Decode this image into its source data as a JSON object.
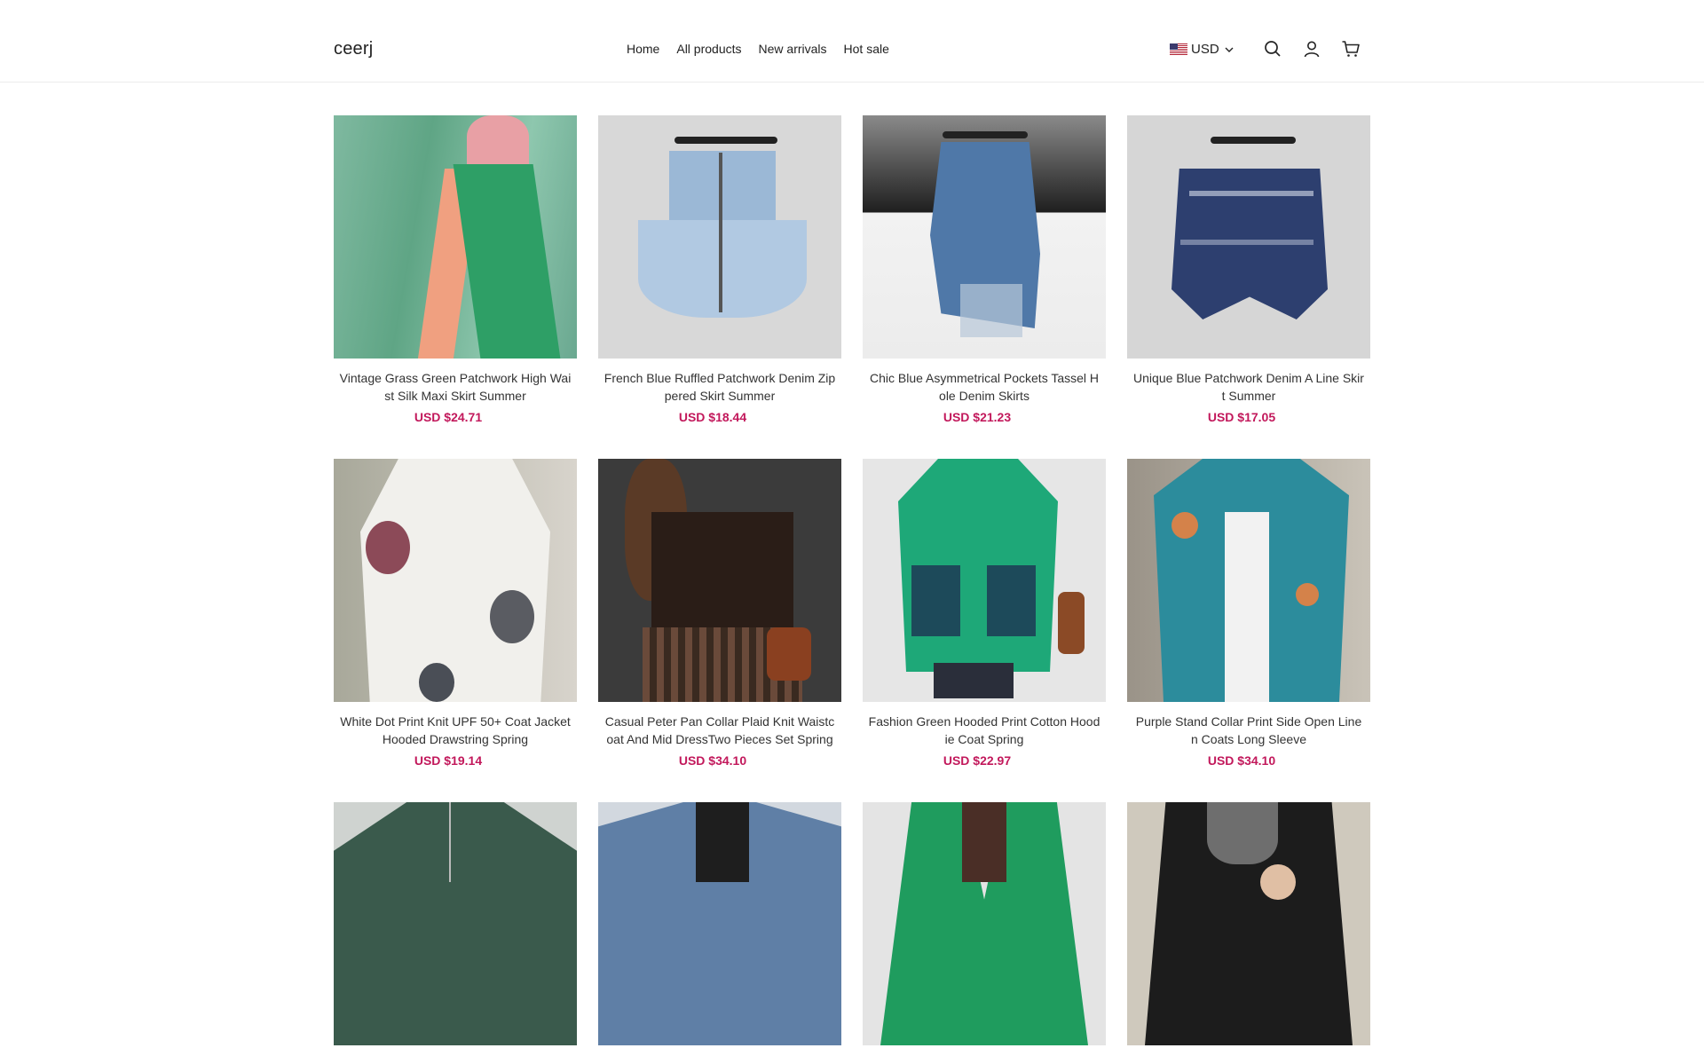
{
  "header": {
    "logo": "ceerj",
    "nav": [
      "Home",
      "All products",
      "New arrivals",
      "Hot sale"
    ],
    "currency": "USD",
    "icons": [
      "us-flag-icon",
      "chevron-down-icon",
      "search-icon",
      "account-icon",
      "cart-icon"
    ]
  },
  "products": [
    {
      "title": "Vintage Grass Green Patchwork High Waist Silk Maxi Skirt Summer",
      "price": "USD $24.71"
    },
    {
      "title": "French Blue Ruffled Patchwork Denim Zippered Skirt Summer",
      "price": "USD $18.44"
    },
    {
      "title": "Chic Blue Asymmetrical Pockets Tassel Hole Denim Skirts",
      "price": "USD $21.23"
    },
    {
      "title": "Unique Blue Patchwork Denim A Line Skirt Summer",
      "price": "USD $17.05"
    },
    {
      "title": "White Dot Print Knit UPF 50+ Coat Jacket Hooded Drawstring Spring",
      "price": "USD $19.14"
    },
    {
      "title": "Casual Peter Pan Collar Plaid Knit Waistcoat And Mid DressTwo Pieces Set Spring",
      "price": "USD $34.10"
    },
    {
      "title": "Fashion Green Hooded Print Cotton Hoodie Coat Spring",
      "price": "USD $22.97"
    },
    {
      "title": "Purple Stand Collar Print Side Open Linen Coats Long Sleeve",
      "price": "USD $34.10"
    },
    {
      "title": "",
      "price": ""
    },
    {
      "title": "",
      "price": ""
    },
    {
      "title": "",
      "price": ""
    },
    {
      "title": "",
      "price": ""
    }
  ],
  "colors": {
    "price": "#c2185b",
    "text": "#333333",
    "border": "#ececec"
  }
}
